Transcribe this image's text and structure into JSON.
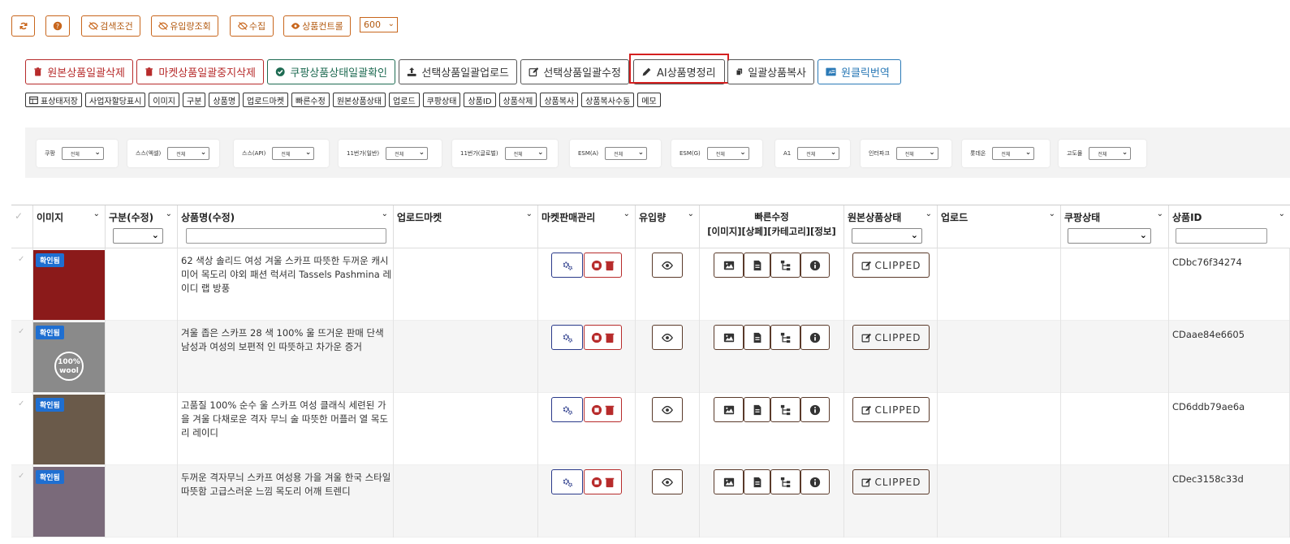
{
  "toolbar": {
    "refresh_icon": "refresh-icon",
    "help_icon": "question-icon",
    "search_cond": "검색조건",
    "inflow_query": "유입량조회",
    "collect": "수집",
    "product_control": "상품컨트롤",
    "page_size": "600"
  },
  "actions": {
    "delete_original": "원본상품일괄삭제",
    "delete_market": "마켓상품일괄중지삭제",
    "coupang_check": "쿠팡상품상태일괄확인",
    "bulk_upload": "선택상품일괄업로드",
    "bulk_edit": "선택상품일괄수정",
    "ai_name": "AI상품명정리",
    "bulk_copy": "일괄상품복사",
    "one_click_translate": "원클릭번역"
  },
  "column_tags": [
    "표상태저장",
    "사업자할당표시",
    "이미지",
    "구분",
    "상품명",
    "업로드마켓",
    "빠른수정",
    "원본상품상태",
    "업로드",
    "쿠팡상태",
    "상품ID",
    "상품삭제",
    "상품복사",
    "상품복사수동",
    "메모"
  ],
  "filters": [
    {
      "label": "쿠팡",
      "value": "전체"
    },
    {
      "label": "스스(엑셀)",
      "value": "전체"
    },
    {
      "label": "스스(API)",
      "value": "전체"
    },
    {
      "label": "11번가(일반)",
      "value": "전체"
    },
    {
      "label": "11번가(글로벌)",
      "value": "전체"
    },
    {
      "label": "ESM(A)",
      "value": "전체"
    },
    {
      "label": "ESM(G)",
      "value": "전체"
    },
    {
      "label": "A1",
      "value": "전체"
    },
    {
      "label": "인터파크",
      "value": "전체"
    },
    {
      "label": "롯데온",
      "value": "전체"
    },
    {
      "label": "고도몰",
      "value": "전체"
    }
  ],
  "columns": {
    "image": "이미지",
    "category": "구분(수정)",
    "product_name": "상품명(수정)",
    "upload_market": "업로드마켓",
    "market_sales": "마켓판매관리",
    "inflow": "유입량",
    "quick_edit": "빠른수정",
    "quick_edit_sub": "[이미지][상페][카테고리][정보]",
    "original_status": "원본상품상태",
    "upload": "업로드",
    "coupang_status": "쿠팡상태",
    "product_id": "상품ID"
  },
  "rows": [
    {
      "badge": "확인됨",
      "name": "62 색상 솔리드 여성 겨울 스카프 따뜻한 두꺼운 캐시미어 목도리 야외 패션 럭셔리 Tassels Pashmina 레이디 랩 방풍",
      "status": "CLIPPED",
      "id": "CDbc76f34274",
      "thumb_color": "#8b1a1a"
    },
    {
      "badge": "확인됨",
      "name": "겨울 좁은 스카프 28 색 100% 울 뜨거운 판매 단색 남성과 여성의 보편적 인 따뜻하고 차가운 증거",
      "status": "CLIPPED",
      "id": "CDaae84e6605",
      "thumb_color": "#8a8a8a",
      "thumb_text": "100% wool"
    },
    {
      "badge": "확인됨",
      "name": "고품질 100% 순수 울 스카프 여성 클래식 세련된 가을 겨울 다채로운 격자 무늬 술 따뜻한 머플러 열 목도리 레이디",
      "status": "CLIPPED",
      "id": "CD6ddb79ae6a",
      "thumb_color": "#6a5a4a"
    },
    {
      "badge": "확인됨",
      "name": "두꺼운 격자무늬 스카프 여성용 가을 겨울 한국 스타일 따뜻함 고급스러운 느낌 목도리 어깨 트렌디",
      "status": "CLIPPED",
      "id": "CDec3158c33d",
      "thumb_color": "#7a6a7a"
    }
  ],
  "colors": {
    "orange": "#c8661c",
    "red": "#b72b2b",
    "green": "#1e6b52",
    "blue": "#2b7ab7",
    "navy": "#2a3a8a",
    "highlight": "#d42020"
  }
}
